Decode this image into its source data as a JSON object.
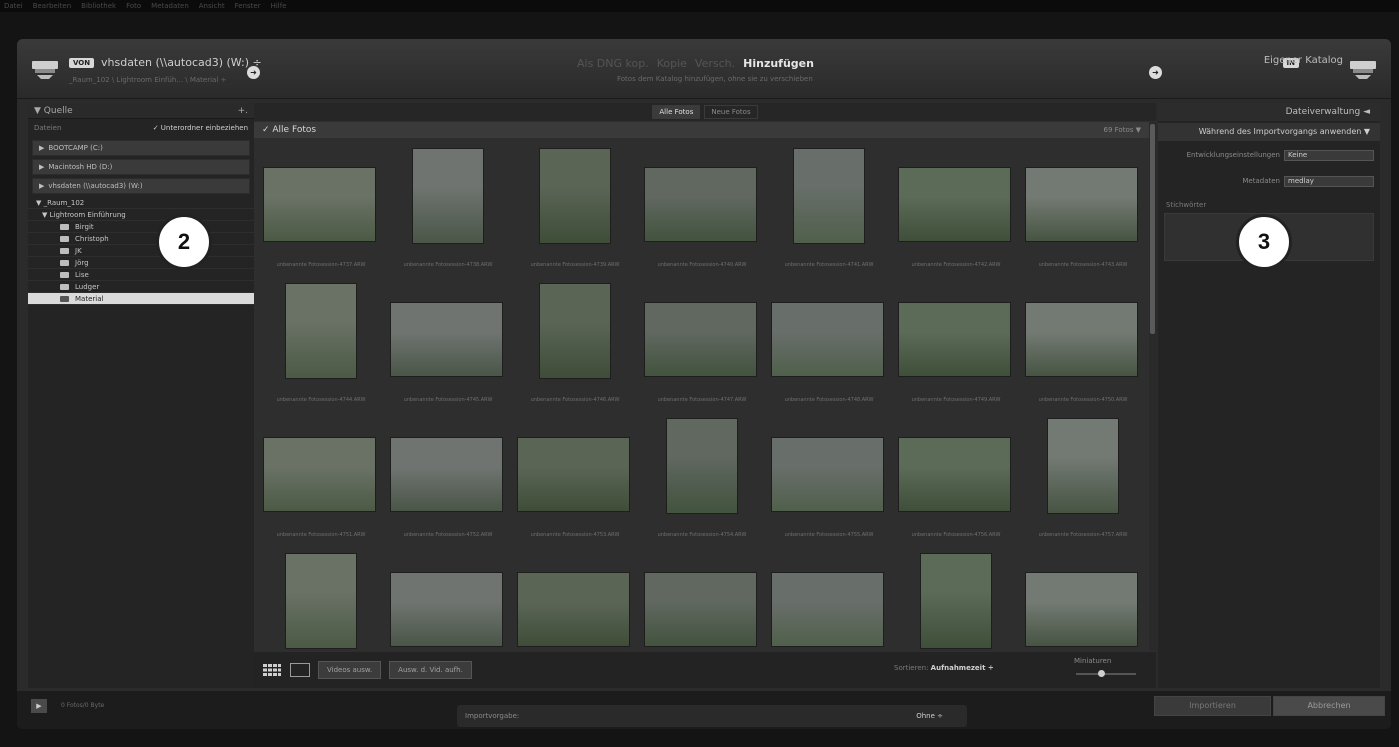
{
  "menu": [
    "Datei",
    "Bearbeiten",
    "Bibliothek",
    "Foto",
    "Metadaten",
    "Ansicht",
    "Fenster",
    "Hilfe"
  ],
  "header": {
    "source_badge": "VON",
    "source_title": "vhsdaten (\\\\autocad3) (W:) ÷",
    "source_path": "_Raum_102 \\ Lightroom Einfüh... \\ Material ÷",
    "modes": [
      "Als DNG kop.",
      "Kopie",
      "Versch.",
      "Hinzufügen"
    ],
    "active_mode": "Hinzufügen",
    "mode_subtitle": "Fotos dem Katalog hinzufügen, ohne sie zu verschieben",
    "dest_badge": "IN",
    "dest_title": "Eigener Katalog"
  },
  "left": {
    "title": "Quelle",
    "plus": "+.",
    "files_label": "Dateien",
    "include_sub": "✓ Unterordner einbeziehen",
    "volumes": [
      "BOOTCAMP (C:)",
      "Macintosh HD (D:)",
      "vhsdaten (\\\\autocad3) (W:)"
    ],
    "tree": [
      {
        "label": "▼ _Raum_102",
        "indent": 8,
        "folder": false
      },
      {
        "label": "▼ Lightroom Einführung",
        "indent": 14,
        "folder": false
      },
      {
        "label": "Birgit",
        "indent": 32,
        "folder": true
      },
      {
        "label": "Christoph",
        "indent": 32,
        "folder": true
      },
      {
        "label": "JK",
        "indent": 32,
        "folder": true
      },
      {
        "label": "Jörg",
        "indent": 32,
        "folder": true
      },
      {
        "label": "Lise",
        "indent": 32,
        "folder": true
      },
      {
        "label": "Ludger",
        "indent": 32,
        "folder": true
      },
      {
        "label": "Material",
        "indent": 32,
        "folder": true,
        "selected": true
      }
    ]
  },
  "center": {
    "tab_all": "Alle Fotos",
    "tab_new": "Neue Fotos",
    "grid_title": "✓ Alle Fotos",
    "grid_count": "69 Fotos ▼",
    "photos": [
      "unbenannte Fotosession-4737.ARW",
      "unbenannte Fotosession-4738.ARW",
      "unbenannte Fotosession-4739.ARW",
      "unbenannte Fotosession-4740.ARW",
      "unbenannte Fotosession-4741.ARW",
      "unbenannte Fotosession-4742.ARW",
      "unbenannte Fotosession-4743.ARW",
      "unbenannte Fotosession-4744.ARW",
      "unbenannte Fotosession-4745.ARW",
      "unbenannte Fotosession-4746.ARW",
      "unbenannte Fotosession-4747.ARW",
      "unbenannte Fotosession-4748.ARW",
      "unbenannte Fotosession-4749.ARW",
      "unbenannte Fotosession-4750.ARW",
      "unbenannte Fotosession-4751.ARW",
      "unbenannte Fotosession-4752.ARW",
      "unbenannte Fotosession-4753.ARW",
      "unbenannte Fotosession-4754.ARW",
      "unbenannte Fotosession-4755.ARW",
      "unbenannte Fotosession-4756.ARW",
      "unbenannte Fotosession-4757.ARW",
      "",
      "",
      "",
      "",
      "",
      "",
      ""
    ],
    "videos_btn": "Videos ausw.",
    "desel_btn": "Ausw. d. Vid. aufh.",
    "sort_label": "Sortieren:",
    "sort_value": "Aufnahmezeit ÷",
    "thumbs_label": "Miniaturen"
  },
  "right": {
    "title": "Dateiverwaltung ◄",
    "section": "Während des Importvorgangs anwenden ▼",
    "dev_label": "Entwicklungseinstellungen",
    "dev_value": "Keine",
    "meta_label": "Metadaten",
    "meta_value": "medlay",
    "keywords_label": "Stichwörter"
  },
  "bottom": {
    "bytes": "0 Fotos/0 Byte",
    "preset_label": "Importvorgabe:",
    "preset_value": "Ohne ÷",
    "import": "Importieren",
    "cancel": "Abbrechen"
  },
  "callouts": [
    "2",
    "3"
  ]
}
